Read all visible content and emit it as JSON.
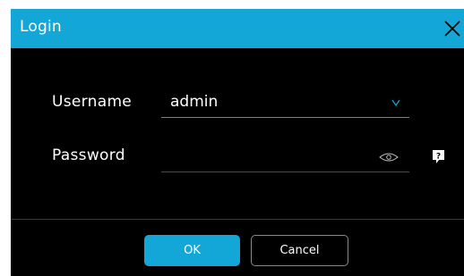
{
  "dialog": {
    "title": "Login",
    "close_icon": "close-icon"
  },
  "form": {
    "username": {
      "label": "Username",
      "value": "admin",
      "dropdown_icon": "chevron-down-icon"
    },
    "password": {
      "label": "Password",
      "value": "",
      "placeholder": "",
      "toggle_icon": "eye-icon"
    },
    "help_icon": "question-mark-icon"
  },
  "buttons": {
    "ok_label": "OK",
    "cancel_label": "Cancel"
  },
  "colors": {
    "accent": "#12a7d6",
    "background": "#000000",
    "text": "#ffffff"
  }
}
